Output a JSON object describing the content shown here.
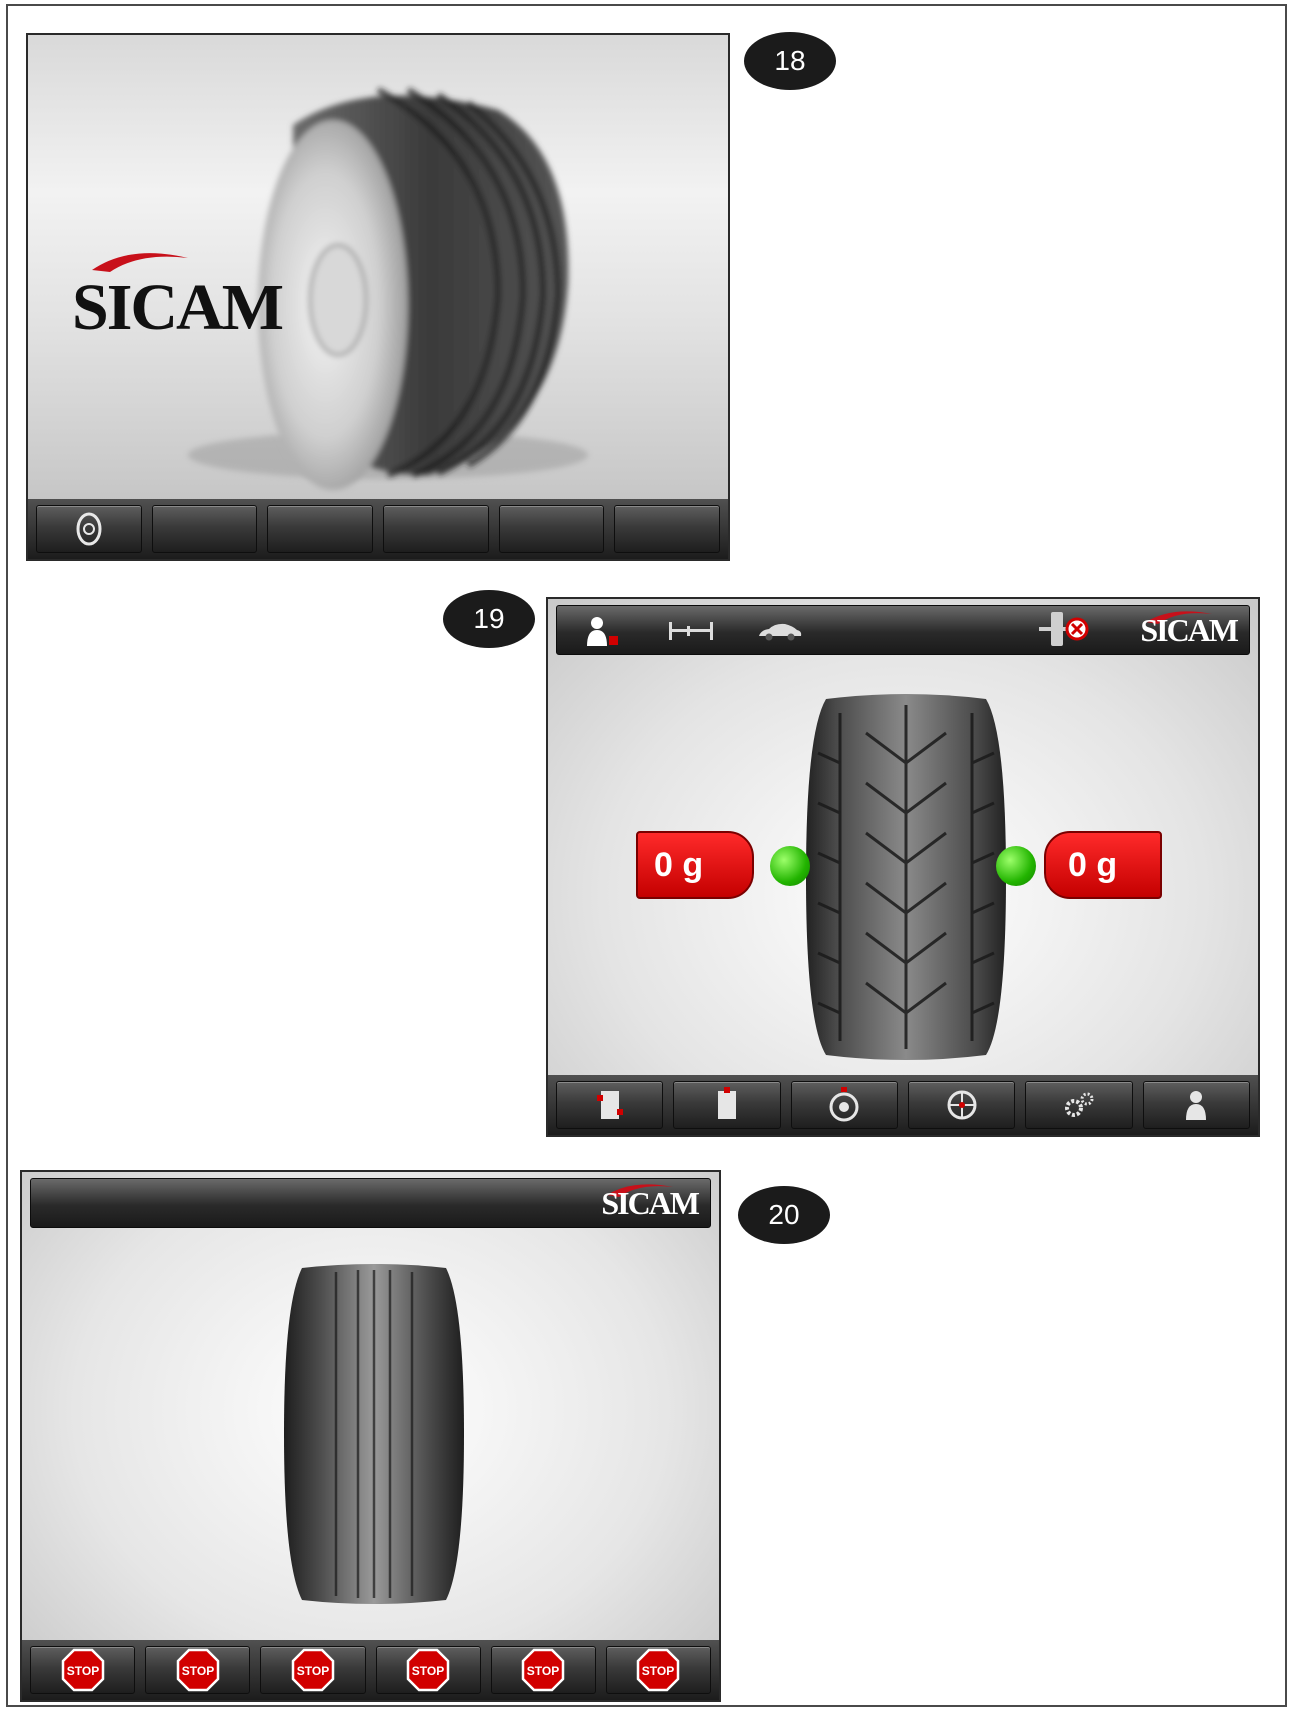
{
  "steps": [
    {
      "number": "18"
    },
    {
      "number": "19"
    },
    {
      "number": "20"
    }
  ],
  "brand": {
    "name": "SICAM",
    "swoosh_color": "#c8101a"
  },
  "screen19": {
    "left_weight": "0 g",
    "right_weight": "0 g",
    "status_dot_color": "#22b400",
    "top_icons": [
      "operator-icon",
      "axle-icon",
      "car-icon",
      "sensor-error-icon"
    ],
    "function_keys": [
      "dynamic-balancing-icon",
      "static-balancing-icon",
      "wheel-data-icon",
      "wheel-position-icon",
      "settings-gears-icon",
      "operator-icon"
    ]
  },
  "screen18": {
    "function_keys": [
      "wheel-icon",
      "",
      "",
      "",
      "",
      ""
    ]
  },
  "screen20": {
    "stop_label": "STOP",
    "function_keys": [
      "STOP",
      "STOP",
      "STOP",
      "STOP",
      "STOP",
      "STOP"
    ]
  },
  "colors": {
    "accent_red": "#d10000",
    "badge": "#1b1b1b",
    "green": "#22b400"
  }
}
